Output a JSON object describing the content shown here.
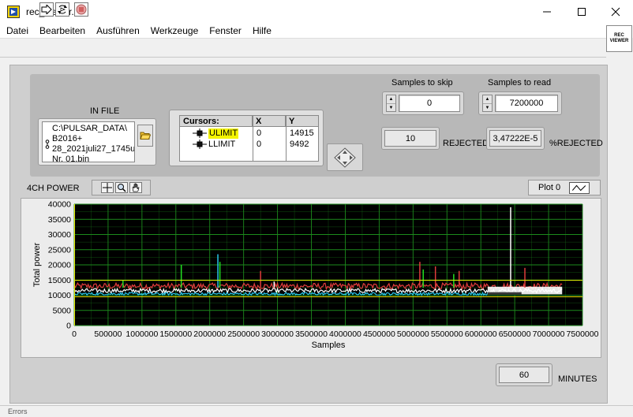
{
  "window": {
    "title": "rec_viewer.vi",
    "icons": {
      "minimize": "minimize-icon",
      "maximize": "maximize-icon",
      "close": "close-icon",
      "app": "labview-vi-icon"
    }
  },
  "menu": [
    "Datei",
    "Bearbeiten",
    "Ausführen",
    "Werkzeuge",
    "Fenster",
    "Hilfe"
  ],
  "toolbar": {
    "icons": [
      "run-arrow-icon",
      "run-continuously-icon",
      "abort-icon"
    ],
    "vi_icon_text": [
      "REC",
      "VIEWER"
    ]
  },
  "infile": {
    "label": "IN FILE",
    "path_lines": [
      "C:\\PULSAR_DATA\\",
      "B2016+",
      "28_2021juli27_1745u",
      "Nr. 01.bin"
    ],
    "browse_icon": "folder-icon"
  },
  "cursors": {
    "headers": [
      "Cursors:",
      "X",
      "Y"
    ],
    "rows": [
      {
        "name": "ULIMIT",
        "x": "0",
        "y": "14915",
        "highlight": "#f4f400"
      },
      {
        "name": "LLIMIT",
        "x": "0",
        "y": "9492"
      }
    ],
    "move_icon": "cursor-move-diamond-icon"
  },
  "samples_to_skip": {
    "label": "Samples to skip",
    "value": "0"
  },
  "samples_to_read": {
    "label": "Samples to read",
    "value": "7200000"
  },
  "rejected": {
    "value": "10",
    "label": "REJECTED"
  },
  "pct_rejected": {
    "value": "3,47222E-5",
    "label": "%REJECTED"
  },
  "graph": {
    "label": "4CH POWER",
    "tools": [
      "cursor-crosshair-icon",
      "zoom-icon",
      "pan-hand-icon"
    ],
    "legend_name": "Plot 0",
    "colors": {
      "background": "#000000",
      "grid": "#1c8a1c",
      "limit_line": "#e8e800",
      "trace_red": "#e03c3c",
      "trace_white": "#ffffff",
      "trace_cyan": "#29c4e8",
      "trace_green": "#22e022"
    }
  },
  "minutes": {
    "value": "60",
    "label": "MINUTES"
  },
  "status": "Errors",
  "chart_data": {
    "type": "line",
    "title": "",
    "xlabel": "Samples",
    "ylabel": "Total power",
    "xlim": [
      0,
      7500000
    ],
    "ylim": [
      0,
      40000
    ],
    "x_ticks": [
      0,
      500000,
      1000000,
      1500000,
      2000000,
      2500000,
      3000000,
      3500000,
      4000000,
      4500000,
      5000000,
      5500000,
      6000000,
      6500000,
      7000000,
      7500000
    ],
    "y_ticks": [
      0,
      5000,
      10000,
      15000,
      20000,
      25000,
      30000,
      35000,
      40000
    ],
    "grid": true,
    "hlines": [
      {
        "name": "ULIMIT",
        "y": 14915
      },
      {
        "name": "LLIMIT",
        "y": 9492
      }
    ],
    "series": [
      {
        "color": "#e03c3c",
        "band": [
          12000,
          14000
        ],
        "x_range": [
          0,
          7200000
        ]
      },
      {
        "color": "#ffffff",
        "band": [
          10800,
          12200
        ],
        "x_range": [
          0,
          7200000
        ]
      },
      {
        "color": "#29c4e8",
        "band": [
          10000,
          10900
        ],
        "x_range": [
          0,
          6100000
        ]
      }
    ],
    "spikes": [
      {
        "x": 720000,
        "y": 15000,
        "color": "#22e022"
      },
      {
        "x": 1580000,
        "y": 20000,
        "color": "#22e022"
      },
      {
        "x": 2120000,
        "y": 23500,
        "color": "#29c4e8"
      },
      {
        "x": 2150000,
        "y": 21000,
        "color": "#22e022"
      },
      {
        "x": 2750000,
        "y": 18000,
        "color": "#e03c3c"
      },
      {
        "x": 2950000,
        "y": 14500,
        "color": "#ffffff"
      },
      {
        "x": 5100000,
        "y": 21000,
        "color": "#e03c3c"
      },
      {
        "x": 5150000,
        "y": 18500,
        "color": "#22e022"
      },
      {
        "x": 5330000,
        "y": 19500,
        "color": "#e03c3c"
      },
      {
        "x": 5600000,
        "y": 17000,
        "color": "#22e022"
      },
      {
        "x": 5680000,
        "y": 18000,
        "color": "#e03c3c"
      },
      {
        "x": 6440000,
        "y": 39000,
        "color": "#ffffff"
      },
      {
        "x": 6650000,
        "y": 19000,
        "color": "#e03c3c"
      }
    ]
  }
}
